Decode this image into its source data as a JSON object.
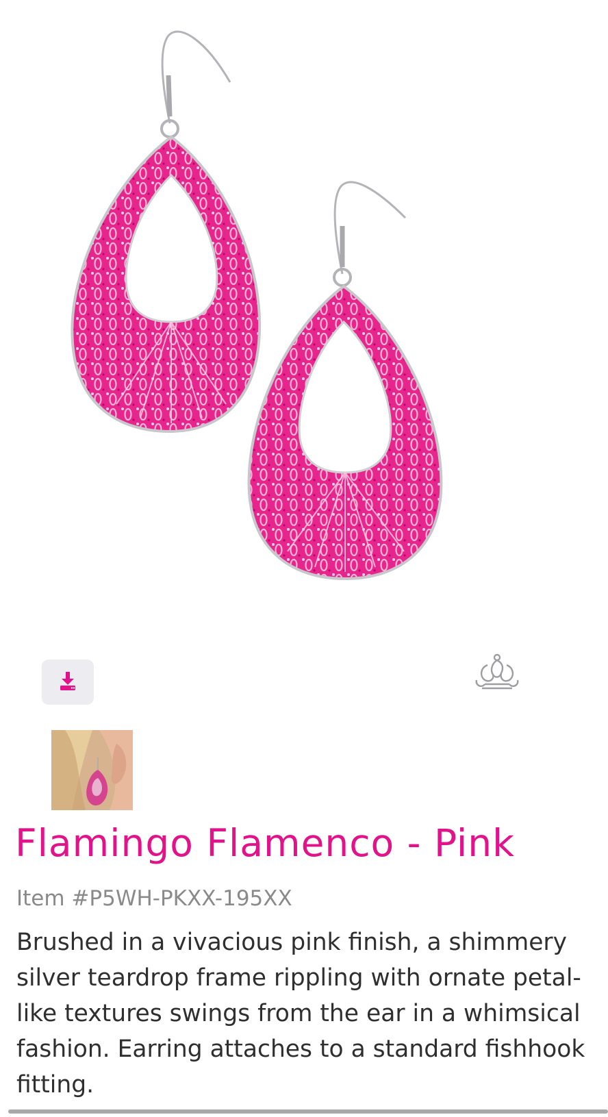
{
  "product": {
    "title": "Flamingo Flamenco - Pink",
    "item_number": "Item #P5WH-PKXX-195XX",
    "description": "Brushed in a vivacious pink finish, a shimmery silver teardrop frame rippling with ornate petal-like textures swings from the ear in a whimsical fashion. Earring attaches to a standard fishhook fitting."
  },
  "actions": {
    "download_icon": "download-icon",
    "crown_icon": "crown-icon"
  },
  "colors": {
    "accent": "#e1128a",
    "earring_pink": "#e7268d",
    "silver": "#b9b9be",
    "button_bg": "#ececf1"
  }
}
